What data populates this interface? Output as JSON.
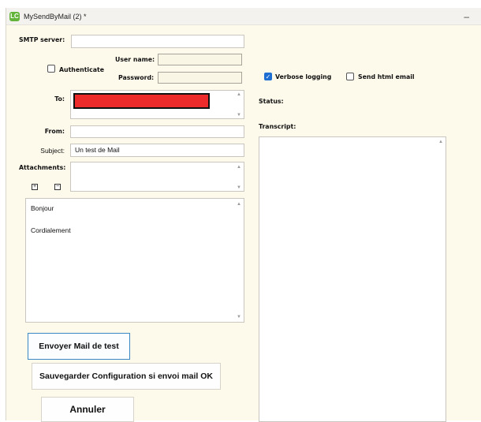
{
  "window": {
    "title": "MySendByMail (2) *"
  },
  "form": {
    "smtp_label": "SMTP server:",
    "smtp_value": "",
    "authenticate_label": "Authenticate",
    "username_label": "User name:",
    "username_value": "",
    "password_label": "Password:",
    "password_value": "",
    "to_label": "To:",
    "from_label": "From:",
    "from_value": "",
    "subject_label": "Subject:",
    "subject_value": "Un test de Mail",
    "attachments_label": "Attachments:",
    "attach_add": "+",
    "attach_remove": "−",
    "body_line1": "Bonjour",
    "body_line2": "Cordialement"
  },
  "options": {
    "verbose_label": "Verbose logging",
    "verbose_checked": true,
    "html_label": "Send html email",
    "html_checked": false,
    "status_label": "Status:",
    "transcript_label": "Transcript:"
  },
  "buttons": {
    "send_test": "Envoyer Mail de test",
    "save_config": "Sauvegarder Configuration si envoi mail OK",
    "cancel": "Annuler"
  },
  "icons": {
    "app": "app-logo-icon",
    "minimize": "minimize-icon",
    "scroll_up": "scroll-up-arrow-icon",
    "scroll_down": "scroll-down-arrow-icon",
    "checkmark": "checkmark-icon"
  },
  "colors": {
    "window_bg": "#fdf9eb",
    "accent": "#1e6fd1",
    "redaction": "#ee2b2b"
  }
}
